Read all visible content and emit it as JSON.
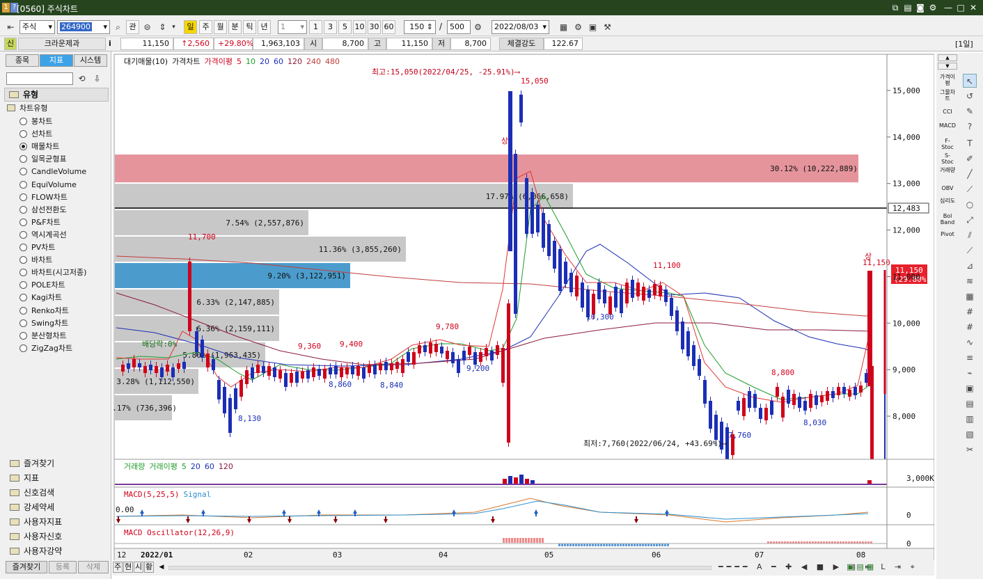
{
  "window": {
    "title": "[0560] 주식차트",
    "icon1": "1",
    "icon2": "?"
  },
  "toolbar": {
    "market": "주식",
    "code": "264900",
    "kwan": "관",
    "periods": [
      "일",
      "주",
      "월",
      "분",
      "틱",
      "년"
    ],
    "interval": "1",
    "minutes": [
      "1",
      "3",
      "5",
      "10",
      "30",
      "60"
    ],
    "count": "150",
    "total": "500",
    "date": "2022/08/03"
  },
  "quote": {
    "tag": "신",
    "name": "크라운제과",
    "info": "i",
    "price": "11,150",
    "change": "↑2,560",
    "rate": "+29.80%",
    "volume": "1,963,103",
    "open_label": "시",
    "open": "8,700",
    "high_label": "고",
    "high": "11,150",
    "low_label": "저",
    "low": "8,700",
    "strength_label": "체결강도",
    "strength": "122.67",
    "period_tag": "[1일]"
  },
  "sidebar": {
    "tabs": [
      "종목",
      "지표",
      "시스템"
    ],
    "section": "유형",
    "group": "차트유형",
    "items": [
      "봉차트",
      "선차트",
      "매물차트",
      "일목균형표",
      "CandleVolume",
      "EquiVolume",
      "FLOW차트",
      "삼선전환도",
      "P&F차트",
      "역시계곡선",
      "PV차트",
      "바차트",
      "바차트(시고저종)",
      "POLE차트",
      "Kagi차트",
      "Renko차트",
      "Swing차트",
      "분산형차트",
      "ZigZag차트"
    ],
    "selected": 2,
    "folders": [
      "즐겨찾기",
      "지표",
      "신호검색",
      "강세약세",
      "사용자지표",
      "사용자신호",
      "사용자강약"
    ],
    "bottom_tabs": [
      "즐겨찾기",
      "등록",
      "삭제"
    ]
  },
  "chart": {
    "legend": [
      "대기매물(10)",
      "가격차트",
      "가격이평",
      "5",
      "10",
      "20",
      "60",
      "120",
      "240",
      "480"
    ],
    "high_note": "최고:15,050(2022/04/25, -25.91%)⟶",
    "low_note": "최저:7,760(2022/06/24, +43.69%)⟶",
    "price_labels": [
      "11,700",
      "8,130",
      "9,360",
      "9,400",
      "8,860",
      "8,840",
      "9,780",
      "9,200",
      "15,050",
      "11,100",
      "10,300",
      "7,760",
      "8,800",
      "8,030",
      "11,150"
    ],
    "div_label": "배당락:0%",
    "sang": "상",
    "yticks": [
      "15,000",
      "14,000",
      "13,000",
      "12,000",
      "11,000",
      "10,000",
      "9,000",
      "8,000"
    ],
    "current_line": "12,483",
    "last_price": "11,150",
    "last_rate": "(29.80%)",
    "vp_labels": [
      "30.12% (10,222,889)",
      "17.97% (6,066,658)",
      "7.54% (2,557,876)",
      "11.36% (3,855,260)",
      "9.20% (3,122,951)",
      "6.33% (2,147,885)",
      "6.36% (2,159,111)",
      "5.80% (1,963,435)",
      "3.28% (1,112,550)",
      "2.17% (736,396)"
    ],
    "vol_legend": [
      "거래량",
      "거래이평",
      "5",
      "20",
      "60",
      "120"
    ],
    "vol_tick": "3,000K",
    "macd_legend": [
      "MACD(5,25,5)",
      "Signal"
    ],
    "macd_value": "0.00",
    "macd_tick": "0",
    "osc_legend": [
      "MACD Oscillator(12,26,9)"
    ],
    "osc_tick": "0",
    "xlabels": [
      "12",
      "2022/01",
      "02",
      "03",
      "04",
      "05",
      "06",
      "07",
      "08"
    ]
  },
  "rightpanel": {
    "labels": [
      "가격이평",
      "그물차트",
      "CCI",
      "MACD",
      "F-Stoc",
      "S-Stoc",
      "거래량",
      "OBV",
      "심리도",
      "Bol Band",
      "Pivot"
    ]
  },
  "bottombar": {
    "buttons": [
      "주",
      "현",
      "시",
      "황"
    ]
  },
  "colors": {
    "up": "#d0021b",
    "down": "#1b2eb5",
    "highlight_red": "#e5949c",
    "highlight_blue": "#4b9ccc",
    "vp_gray": "#c8c8c8"
  }
}
